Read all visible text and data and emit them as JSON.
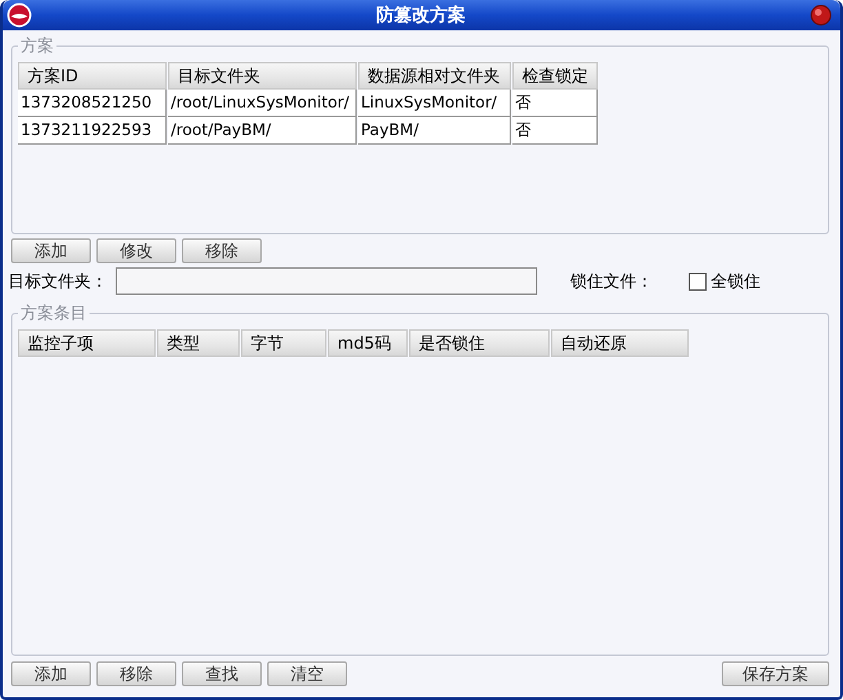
{
  "window": {
    "title": "防篡改方案"
  },
  "plans": {
    "legend": "方案",
    "columns": [
      "方案ID",
      "目标文件夹",
      "数据源相对文件夹",
      "检查锁定"
    ],
    "rows": [
      [
        "1373208521250",
        "/root/LinuxSysMonitor/",
        "LinuxSysMonitor/",
        "否"
      ],
      [
        "1373211922593",
        "/root/PayBM/",
        "PayBM/",
        "否"
      ]
    ]
  },
  "plan_buttons": [
    "添加",
    "修改",
    "移除"
  ],
  "target_folder": {
    "label": "目标文件夹："
  },
  "lock_file": {
    "label": "锁住文件：",
    "checkbox": {
      "label": "全锁住",
      "checked": false
    }
  },
  "items": {
    "legend": "方案条目",
    "columns": [
      "监控子项",
      "类型",
      "字节",
      "md5码",
      "是否锁住",
      "自动还原"
    ]
  },
  "item_buttons": [
    "添加",
    "移除",
    "查找",
    "清空"
  ],
  "save_button": "保存方案"
}
